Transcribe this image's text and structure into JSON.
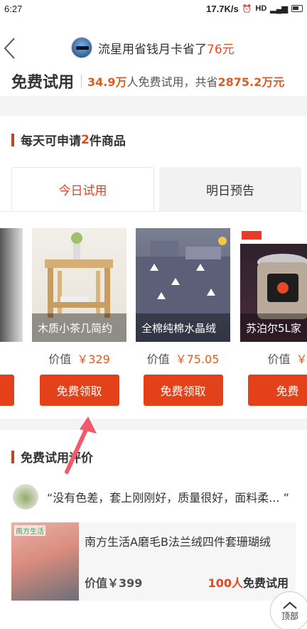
{
  "status_bar": {
    "time": "6:27",
    "speed": "17.7K/s",
    "battery": "4"
  },
  "header": {
    "title_prefix": "流星用省钱月卡省了",
    "title_amount": "76元"
  },
  "summary": {
    "label": "免费试用",
    "users": "34.9万",
    "text_mid": "人免费试用，共省",
    "saved": "2875.2万元"
  },
  "daily": {
    "title_prefix": "每天可申请",
    "count": "2",
    "title_suffix": "件商品"
  },
  "tabs": [
    {
      "label": "今日试用",
      "active": true
    },
    {
      "label": "明日预告",
      "active": false
    }
  ],
  "products": [
    {
      "name": "木质小茶几简约",
      "price_label": "价值",
      "price": "￥329",
      "button": "免费领取"
    },
    {
      "name": "全棉纯棉水晶绒",
      "price_label": "价值",
      "price": "￥75.05",
      "button": "免费领取"
    },
    {
      "name": "苏泊尔5L家",
      "price_label": "价值",
      "price": "￥",
      "button": "免费"
    }
  ],
  "review": {
    "title": "免费试用评价",
    "quote": "“没有色差，套上刚刚好，质量很好，面料柔...  ”",
    "product": {
      "brand": "南方生活",
      "title": "南方生活A磨毛B法兰绒四件套珊瑚绒",
      "price": "价值￥399",
      "trial_count": "100人",
      "trial_text": "免费试用"
    }
  },
  "top_button": "顶部",
  "colors": {
    "accent": "#e2411a",
    "highlight": "#e25a22"
  }
}
